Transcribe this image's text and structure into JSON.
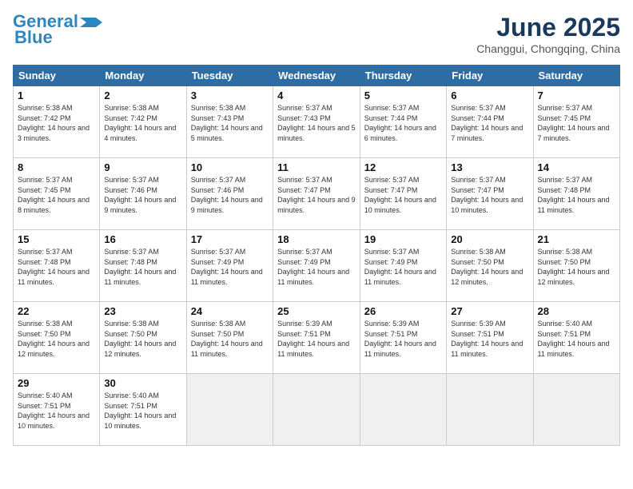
{
  "header": {
    "logo_line1": "General",
    "logo_line2": "Blue",
    "month_year": "June 2025",
    "location": "Changgui, Chongqing, China"
  },
  "days_of_week": [
    "Sunday",
    "Monday",
    "Tuesday",
    "Wednesday",
    "Thursday",
    "Friday",
    "Saturday"
  ],
  "weeks": [
    [
      {
        "day": 1,
        "sunrise": "5:38 AM",
        "sunset": "7:42 PM",
        "daylight": "14 hours and 3 minutes."
      },
      {
        "day": 2,
        "sunrise": "5:38 AM",
        "sunset": "7:42 PM",
        "daylight": "14 hours and 4 minutes."
      },
      {
        "day": 3,
        "sunrise": "5:38 AM",
        "sunset": "7:43 PM",
        "daylight": "14 hours and 5 minutes."
      },
      {
        "day": 4,
        "sunrise": "5:37 AM",
        "sunset": "7:43 PM",
        "daylight": "14 hours and 5 minutes."
      },
      {
        "day": 5,
        "sunrise": "5:37 AM",
        "sunset": "7:44 PM",
        "daylight": "14 hours and 6 minutes."
      },
      {
        "day": 6,
        "sunrise": "5:37 AM",
        "sunset": "7:44 PM",
        "daylight": "14 hours and 7 minutes."
      },
      {
        "day": 7,
        "sunrise": "5:37 AM",
        "sunset": "7:45 PM",
        "daylight": "14 hours and 7 minutes."
      }
    ],
    [
      {
        "day": 8,
        "sunrise": "5:37 AM",
        "sunset": "7:45 PM",
        "daylight": "14 hours and 8 minutes."
      },
      {
        "day": 9,
        "sunrise": "5:37 AM",
        "sunset": "7:46 PM",
        "daylight": "14 hours and 9 minutes."
      },
      {
        "day": 10,
        "sunrise": "5:37 AM",
        "sunset": "7:46 PM",
        "daylight": "14 hours and 9 minutes."
      },
      {
        "day": 11,
        "sunrise": "5:37 AM",
        "sunset": "7:47 PM",
        "daylight": "14 hours and 9 minutes."
      },
      {
        "day": 12,
        "sunrise": "5:37 AM",
        "sunset": "7:47 PM",
        "daylight": "14 hours and 10 minutes."
      },
      {
        "day": 13,
        "sunrise": "5:37 AM",
        "sunset": "7:47 PM",
        "daylight": "14 hours and 10 minutes."
      },
      {
        "day": 14,
        "sunrise": "5:37 AM",
        "sunset": "7:48 PM",
        "daylight": "14 hours and 11 minutes."
      }
    ],
    [
      {
        "day": 15,
        "sunrise": "5:37 AM",
        "sunset": "7:48 PM",
        "daylight": "14 hours and 11 minutes."
      },
      {
        "day": 16,
        "sunrise": "5:37 AM",
        "sunset": "7:48 PM",
        "daylight": "14 hours and 11 minutes."
      },
      {
        "day": 17,
        "sunrise": "5:37 AM",
        "sunset": "7:49 PM",
        "daylight": "14 hours and 11 minutes."
      },
      {
        "day": 18,
        "sunrise": "5:37 AM",
        "sunset": "7:49 PM",
        "daylight": "14 hours and 11 minutes."
      },
      {
        "day": 19,
        "sunrise": "5:37 AM",
        "sunset": "7:49 PM",
        "daylight": "14 hours and 11 minutes."
      },
      {
        "day": 20,
        "sunrise": "5:38 AM",
        "sunset": "7:50 PM",
        "daylight": "14 hours and 12 minutes."
      },
      {
        "day": 21,
        "sunrise": "5:38 AM",
        "sunset": "7:50 PM",
        "daylight": "14 hours and 12 minutes."
      }
    ],
    [
      {
        "day": 22,
        "sunrise": "5:38 AM",
        "sunset": "7:50 PM",
        "daylight": "14 hours and 12 minutes."
      },
      {
        "day": 23,
        "sunrise": "5:38 AM",
        "sunset": "7:50 PM",
        "daylight": "14 hours and 12 minutes."
      },
      {
        "day": 24,
        "sunrise": "5:38 AM",
        "sunset": "7:50 PM",
        "daylight": "14 hours and 11 minutes."
      },
      {
        "day": 25,
        "sunrise": "5:39 AM",
        "sunset": "7:51 PM",
        "daylight": "14 hours and 11 minutes."
      },
      {
        "day": 26,
        "sunrise": "5:39 AM",
        "sunset": "7:51 PM",
        "daylight": "14 hours and 11 minutes."
      },
      {
        "day": 27,
        "sunrise": "5:39 AM",
        "sunset": "7:51 PM",
        "daylight": "14 hours and 11 minutes."
      },
      {
        "day": 28,
        "sunrise": "5:40 AM",
        "sunset": "7:51 PM",
        "daylight": "14 hours and 11 minutes."
      }
    ],
    [
      {
        "day": 29,
        "sunrise": "5:40 AM",
        "sunset": "7:51 PM",
        "daylight": "14 hours and 10 minutes."
      },
      {
        "day": 30,
        "sunrise": "5:40 AM",
        "sunset": "7:51 PM",
        "daylight": "14 hours and 10 minutes."
      },
      null,
      null,
      null,
      null,
      null
    ]
  ]
}
